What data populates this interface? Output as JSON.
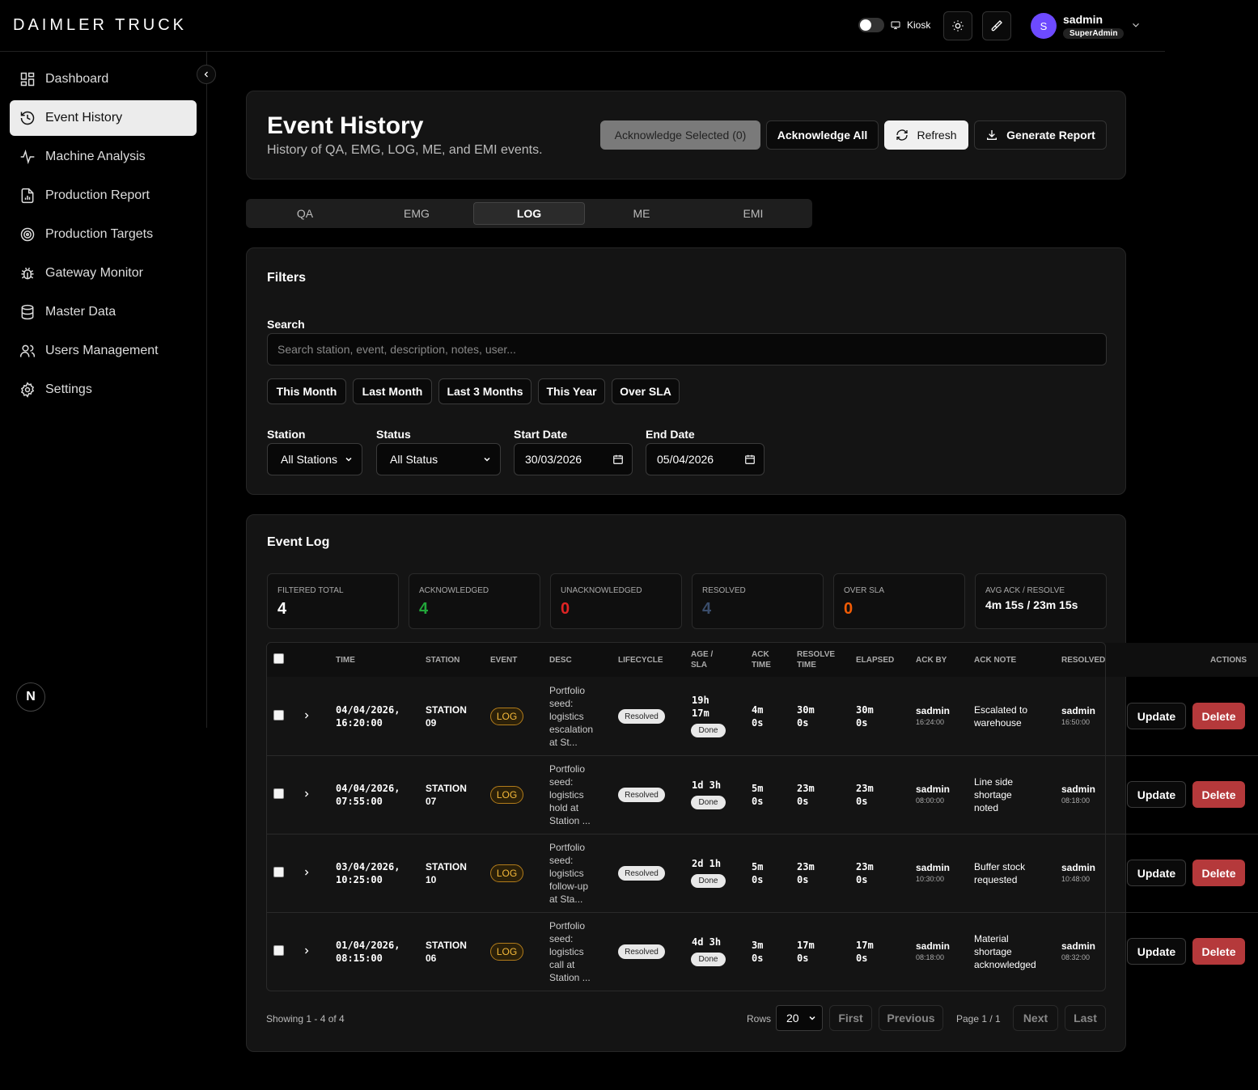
{
  "app": {
    "logo": "DAIMLER TRUCK"
  },
  "header": {
    "kiosk_label": "Kiosk",
    "user": {
      "initial": "S",
      "name": "sadmin",
      "role": "SuperAdmin"
    }
  },
  "sidebar": {
    "items": [
      {
        "label": "Dashboard",
        "icon": "dashboard-icon"
      },
      {
        "label": "Event History",
        "icon": "history-icon",
        "active": true
      },
      {
        "label": "Machine Analysis",
        "icon": "activity-icon"
      },
      {
        "label": "Production Report",
        "icon": "report-icon"
      },
      {
        "label": "Production Targets",
        "icon": "target-icon"
      },
      {
        "label": "Gateway Monitor",
        "icon": "bug-icon"
      },
      {
        "label": "Master Data",
        "icon": "database-icon"
      },
      {
        "label": "Users Management",
        "icon": "users-icon"
      },
      {
        "label": "Settings",
        "icon": "gear-icon"
      }
    ],
    "badge": "N"
  },
  "page": {
    "title": "Event History",
    "subtitle": "History of QA, EMG, LOG, ME, and EMI events.",
    "buttons": {
      "ack_selected": "Acknowledge Selected (0)",
      "ack_all": "Acknowledge All",
      "refresh": "Refresh",
      "report": "Generate Report"
    }
  },
  "tabs": [
    "QA",
    "EMG",
    "LOG",
    "ME",
    "EMI"
  ],
  "active_tab": "LOG",
  "filters": {
    "title": "Filters",
    "search_label": "Search",
    "search_placeholder": "Search station, event, description, notes, user...",
    "chips": [
      "This Month",
      "Last Month",
      "Last 3 Months",
      "This Year",
      "Over SLA"
    ],
    "station_label": "Station",
    "station_value": "All Stations",
    "status_label": "Status",
    "status_value": "All Status",
    "start_label": "Start Date",
    "start_value": "30/03/2026",
    "end_label": "End Date",
    "end_value": "05/04/2026"
  },
  "log": {
    "title": "Event Log",
    "stats": [
      {
        "label": "FILTERED TOTAL",
        "value": "4",
        "color": "#ffffff"
      },
      {
        "label": "ACKNOWLEDGED",
        "value": "4",
        "color": "#22a63a"
      },
      {
        "label": "UNACKNOWLEDGED",
        "value": "0",
        "color": "#e02424"
      },
      {
        "label": "RESOLVED",
        "value": "4",
        "color": "#3a4d6b"
      },
      {
        "label": "OVER SLA",
        "value": "0",
        "color": "#f25c05"
      },
      {
        "label": "AVG ACK / RESOLVE",
        "value": "4m 15s / 23m 15s",
        "color": "#ffffff"
      }
    ],
    "columns": [
      "TIME",
      "STATION",
      "EVENT",
      "DESC",
      "LIFECYCLE",
      "AGE /",
      "SLA",
      "ACK",
      "TIME",
      "RESOLVE",
      "TIME",
      "ELAPSED",
      "ACK BY",
      "ACK NOTE",
      "RESOLVED",
      "ACTIONS"
    ],
    "rows": [
      {
        "time1": "04/04/2026,",
        "time2": "16:20:00",
        "station1": "STATION",
        "station2": "09",
        "event": "LOG",
        "desc": [
          "Portfolio",
          "seed:",
          "logistics",
          "escalation",
          "at St..."
        ],
        "lifecycle": "Resolved",
        "age1": "19h",
        "age2": "17m",
        "sla": "Done",
        "ack1": "4m",
        "ack2": "0s",
        "res1": "30m",
        "res2": "0s",
        "el1": "30m",
        "el2": "0s",
        "ack_by": "sadmin",
        "ack_by_time": "16:24:00",
        "note": [
          "Escalated to",
          "warehouse"
        ],
        "resolved_by": "sadmin",
        "resolved_time": "16:50:00",
        "update": "Update",
        "delete": "Delete"
      },
      {
        "time1": "04/04/2026,",
        "time2": "07:55:00",
        "station1": "STATION",
        "station2": "07",
        "event": "LOG",
        "desc": [
          "Portfolio",
          "seed:",
          "logistics",
          "hold at",
          "Station ..."
        ],
        "lifecycle": "Resolved",
        "age1": "1d 3h",
        "age2": "",
        "sla": "Done",
        "ack1": "5m",
        "ack2": "0s",
        "res1": "23m",
        "res2": "0s",
        "el1": "23m",
        "el2": "0s",
        "ack_by": "sadmin",
        "ack_by_time": "08:00:00",
        "note": [
          "Line side",
          "shortage",
          "noted"
        ],
        "resolved_by": "sadmin",
        "resolved_time": "08:18:00",
        "update": "Update",
        "delete": "Delete"
      },
      {
        "time1": "03/04/2026,",
        "time2": "10:25:00",
        "station1": "STATION",
        "station2": "10",
        "event": "LOG",
        "desc": [
          "Portfolio",
          "seed:",
          "logistics",
          "follow-up",
          "at Sta..."
        ],
        "lifecycle": "Resolved",
        "age1": "2d 1h",
        "age2": "",
        "sla": "Done",
        "ack1": "5m",
        "ack2": "0s",
        "res1": "23m",
        "res2": "0s",
        "el1": "23m",
        "el2": "0s",
        "ack_by": "sadmin",
        "ack_by_time": "10:30:00",
        "note": [
          "Buffer stock",
          "requested"
        ],
        "resolved_by": "sadmin",
        "resolved_time": "10:48:00",
        "update": "Update",
        "delete": "Delete"
      },
      {
        "time1": "01/04/2026,",
        "time2": "08:15:00",
        "station1": "STATION",
        "station2": "06",
        "event": "LOG",
        "desc": [
          "Portfolio",
          "seed:",
          "logistics",
          "call at",
          "Station ..."
        ],
        "lifecycle": "Resolved",
        "age1": "4d 3h",
        "age2": "",
        "sla": "Done",
        "ack1": "3m",
        "ack2": "0s",
        "res1": "17m",
        "res2": "0s",
        "el1": "17m",
        "el2": "0s",
        "ack_by": "sadmin",
        "ack_by_time": "08:18:00",
        "note": [
          "Material",
          "shortage",
          "acknowledged"
        ],
        "resolved_by": "sadmin",
        "resolved_time": "08:32:00",
        "update": "Update",
        "delete": "Delete"
      }
    ]
  },
  "pagination": {
    "showing": "Showing 1 - 4 of 4",
    "rows_label": "Rows",
    "rows_value": "20",
    "first": "First",
    "previous": "Previous",
    "page": "Page 1 / 1",
    "next": "Next",
    "last": "Last"
  }
}
